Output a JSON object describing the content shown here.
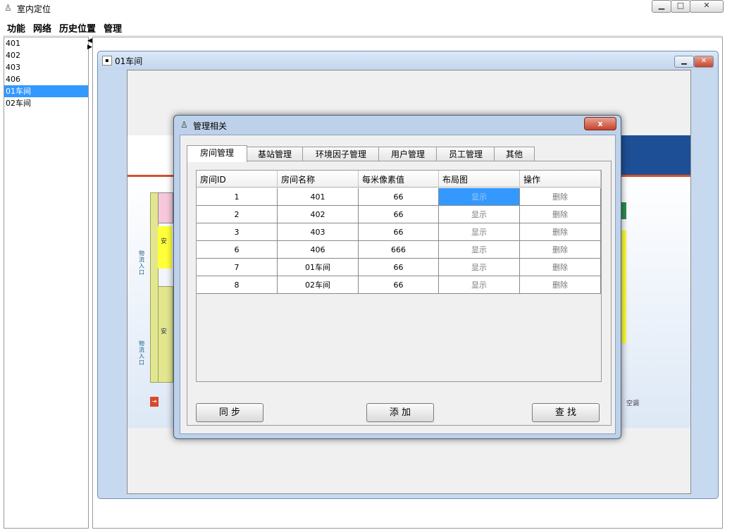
{
  "app": {
    "title": "室内定位",
    "icon": "person-pin-icon",
    "window_controls": [
      "minimize",
      "maximize",
      "close"
    ]
  },
  "menu": [
    "功能",
    "网络",
    "历史位置",
    "管理"
  ],
  "rooms_list": {
    "items": [
      "401",
      "402",
      "403",
      "406",
      "01车间",
      "02车间"
    ],
    "selected_index": 4
  },
  "internal_frame": {
    "title": "01车间"
  },
  "floorplan": {
    "side_text_1": "物流入口",
    "side_text_2": "物流入口",
    "side_label_left": "安",
    "side_label_left2": "安",
    "corner_label": "空调",
    "colors": {
      "banner_blue": "#1d4f96",
      "accent_red": "#d2532b"
    }
  },
  "dialog": {
    "title": "管理相关",
    "close_label": "x",
    "tabs": [
      "房间管理",
      "基站管理",
      "环境因子管理",
      "用户管理",
      "员工管理",
      "其他"
    ],
    "active_tab": 0,
    "table": {
      "columns": [
        "房间ID",
        "房间名称",
        "每米像素值",
        "布局图",
        "操作"
      ],
      "rows": [
        [
          "1",
          "401",
          "66",
          "显示",
          "删除"
        ],
        [
          "2",
          "402",
          "66",
          "显示",
          "删除"
        ],
        [
          "3",
          "403",
          "66",
          "显示",
          "删除"
        ],
        [
          "6",
          "406",
          "666",
          "显示",
          "删除"
        ],
        [
          "7",
          "01车间",
          "66",
          "显示",
          "删除"
        ],
        [
          "8",
          "02车间",
          "66",
          "显示",
          "删除"
        ]
      ],
      "selected_cell": {
        "row": 0,
        "col": 3
      }
    },
    "buttons": {
      "sync": "同 步",
      "add": "添 加",
      "search": "查 找"
    }
  },
  "colors": {
    "selection": "#3399ff",
    "frame_blue": "#c7d9ef"
  }
}
